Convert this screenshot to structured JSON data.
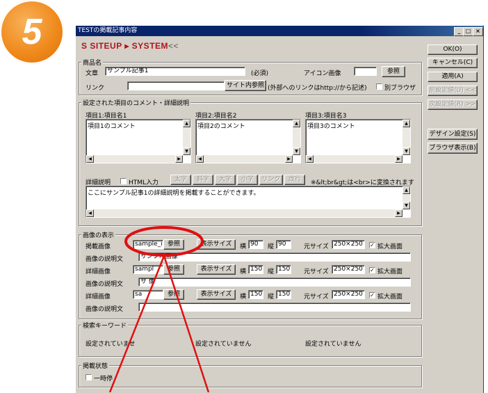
{
  "step_number": "5",
  "window": {
    "title": "TESTの掲載記事内容",
    "controls": [
      "_",
      "□",
      "×"
    ]
  },
  "logo": {
    "main": "SITEUP ▸ SYSTEM",
    "suffix": "<<"
  },
  "side_buttons": {
    "ok": "OK(O)",
    "cancel": "キャンセル(C)",
    "apply": "適用(A)",
    "prev": "前設定値(U) <<",
    "next": "次設定値(R) >>",
    "design": "デザイン設定(S)",
    "browser": "ブラウザ表示(B)"
  },
  "product": {
    "group_label": "商品名",
    "text_label": "文章",
    "text_value": "サンプル記事1",
    "required_label": "(必須)",
    "icon_label": "アイコン画像",
    "browse_button": "参照",
    "link_label": "リンク",
    "link_value": "",
    "site_ref_button": "サイト内参照",
    "link_note": "(外部へのリンクはhttp://から記述)",
    "new_window_label": "別ブラウザ"
  },
  "comments": {
    "group_label": "設定された項目のコメント・詳細説明",
    "items": [
      {
        "label": "項目1:項目名1",
        "value": "項目1のコメント"
      },
      {
        "label": "項目2:項目名2",
        "value": "項目2のコメント"
      },
      {
        "label": "項目3:項目名3",
        "value": "項目3のコメント"
      }
    ],
    "detail_label": "詳細説明",
    "html_input_label": "HTML入力",
    "format_buttons": [
      "太字",
      "斜字",
      "大字",
      "小字",
      "リンク",
      "改行"
    ],
    "br_note": "※&lt;br&gt;は<br>に変換されます",
    "detail_value": "ここにサンプル記事1の詳細説明を掲載することができます。"
  },
  "images": {
    "group_label": "画像の表示",
    "rows": [
      {
        "label": "掲載画像",
        "file": "sample_in",
        "browse": "参照",
        "size_button": "表示サイズ",
        "w_label": "横",
        "w": "90",
        "h_label": "縦",
        "h": "90",
        "orig_label": "元サイズ",
        "orig": "250×250",
        "zoom_label": "拡大画面",
        "desc_label": "画像の説明文",
        "desc": "サンプル画像"
      },
      {
        "label": "詳細画像",
        "file": "sampl",
        "browse": "参照",
        "size_button": "表示サイズ",
        "w_label": "横",
        "w": "150",
        "h_label": "縦",
        "h": "150",
        "orig_label": "元サイズ",
        "orig": "250×250",
        "zoom_label": "拡大画面",
        "desc_label": "画像の説明文",
        "desc": "サ    像"
      },
      {
        "label": "詳細画像",
        "file": "sa",
        "browse": "参照",
        "size_button": "表示サイズ",
        "w_label": "横",
        "w": "150",
        "h_label": "縦",
        "h": "150",
        "orig_label": "元サイズ",
        "orig": "250×250",
        "zoom_label": "拡大画面",
        "desc_label": "画像の説明文",
        "desc": ""
      }
    ]
  },
  "keywords": {
    "group_label": "検索キーワード",
    "values": [
      "設定されていませ",
      "設定されていません",
      "設定されていません"
    ]
  },
  "status": {
    "group_label": "掲載状態",
    "checkbox_label": "一時停"
  },
  "colors": {
    "annotation": "#e01010",
    "badge": "#f08a1c",
    "title_bar": "#0a246a"
  }
}
